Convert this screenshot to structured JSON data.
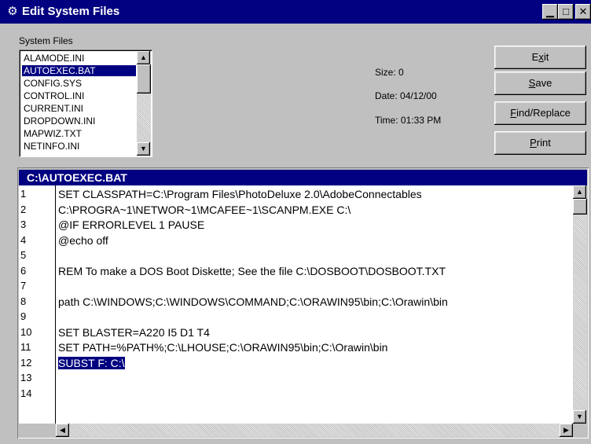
{
  "window": {
    "title": "Edit System Files",
    "icon": "gear-cog-icon"
  },
  "title_buttons": {
    "minimize": "▁",
    "maximize": "□",
    "close": "✕"
  },
  "system_files": {
    "label": "System Files",
    "items": [
      "ALAMODE.INI",
      "AUTOEXEC.BAT",
      "CONFIG.SYS",
      "CONTROL.INI",
      "CURRENT.INI",
      "DROPDOWN.INI",
      "MAPWIZ.TXT",
      "NETINFO.INI"
    ],
    "selected_index": 1
  },
  "file_info": {
    "size": "Size: 0",
    "date": "Date: 04/12/00",
    "time": "Time: 01:33 PM"
  },
  "buttons": {
    "exit": {
      "pre": "E",
      "key": "x",
      "post": "it"
    },
    "save": {
      "pre": "",
      "key": "S",
      "post": "ave"
    },
    "find_replace": {
      "pre": "",
      "key": "F",
      "post": "ind/Replace"
    },
    "print": {
      "pre": "",
      "key": "P",
      "post": "rint"
    }
  },
  "editor": {
    "path": "C:\\AUTOEXEC.BAT",
    "lines": [
      {
        "n": "1",
        "text": "SET CLASSPATH=C:\\Program Files\\PhotoDeluxe 2.0\\AdobeConnectables"
      },
      {
        "n": "2",
        "text": "C:\\PROGRA~1\\NETWOR~1\\MCAFEE~1\\SCANPM.EXE C:\\"
      },
      {
        "n": "3",
        "text": "@IF ERRORLEVEL 1 PAUSE"
      },
      {
        "n": "4",
        "text": "@echo off"
      },
      {
        "n": "5",
        "text": ""
      },
      {
        "n": "6",
        "text": "REM To make a DOS Boot Diskette; See the file C:\\DOSBOOT\\DOSBOOT.TXT"
      },
      {
        "n": "7",
        "text": ""
      },
      {
        "n": "8",
        "text": "path C:\\WINDOWS;C:\\WINDOWS\\COMMAND;C:\\ORAWIN95\\bin;C:\\Orawin\\bin"
      },
      {
        "n": "9",
        "text": ""
      },
      {
        "n": "10",
        "text": "SET BLASTER=A220 I5 D1 T4"
      },
      {
        "n": "11",
        "text": "SET PATH=%PATH%;C:\\LHOUSE;C:\\ORAWIN95\\bin;C:\\Orawin\\bin"
      },
      {
        "n": "12",
        "text": "SUBST F: C:\\"
      },
      {
        "n": "13",
        "text": ""
      },
      {
        "n": "14",
        "text": ""
      }
    ],
    "highlighted_line": 11
  },
  "colors": {
    "titlebar": "#000080",
    "face": "#c0c0c0",
    "selection": "#000080"
  }
}
